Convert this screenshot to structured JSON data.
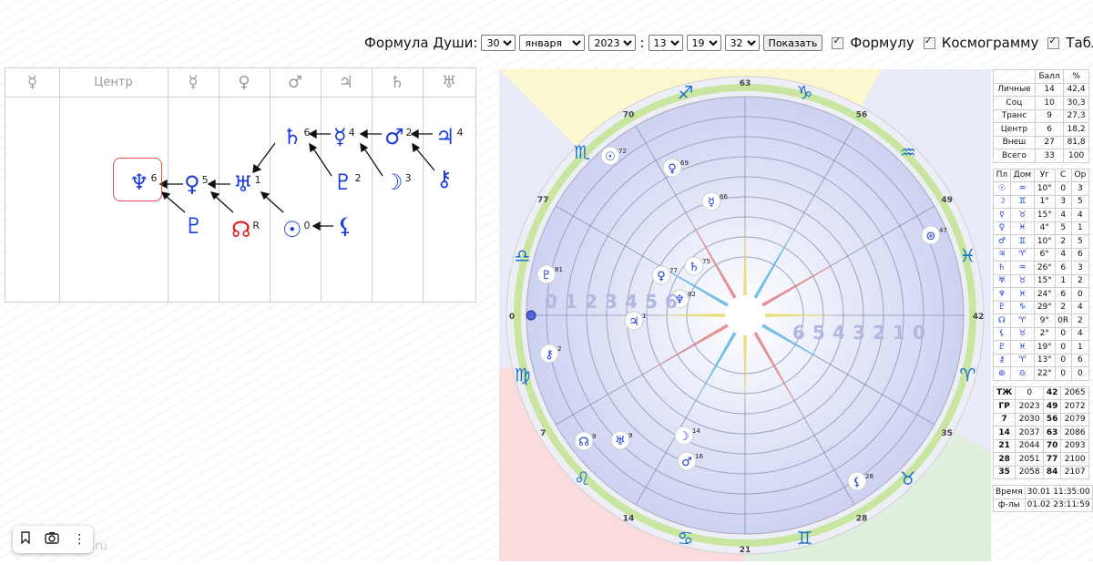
{
  "controls": {
    "label": "Формула Души:",
    "day": "30",
    "month": "января",
    "year": "2023",
    "hour": "13",
    "minute": "19",
    "second": "32",
    "show_button": "Показать",
    "toggles": [
      "Формулу",
      "Космограмму",
      "Табли"
    ]
  },
  "formula": {
    "header": [
      "☿",
      "Центр",
      "☿",
      "♀",
      "♂",
      "♃",
      "♄",
      "♅"
    ],
    "nodes": [
      {
        "id": "neptune",
        "glyph": "♆",
        "num": "6"
      },
      {
        "id": "venus",
        "glyph": "♀",
        "num": "5"
      },
      {
        "id": "uranus",
        "glyph": "♅",
        "num": "1"
      },
      {
        "id": "saturn",
        "glyph": "♄",
        "num": "6"
      },
      {
        "id": "mercury",
        "glyph": "☿",
        "num": "4"
      },
      {
        "id": "mars",
        "glyph": "♂",
        "num": "2"
      },
      {
        "id": "jupiter",
        "glyph": "♃",
        "num": "4"
      },
      {
        "id": "pluto",
        "glyph": "♇",
        "num": "2"
      },
      {
        "id": "moon",
        "glyph": "☽",
        "num": "3"
      },
      {
        "id": "chiron",
        "glyph": "⚷",
        "num": ""
      },
      {
        "id": "proserpina",
        "glyph": "♇",
        "num": ""
      },
      {
        "id": "node",
        "glyph": "☊",
        "num": "R"
      },
      {
        "id": "sun",
        "glyph": "☉",
        "num": "0"
      },
      {
        "id": "lilith",
        "glyph": "⚸",
        "num": ""
      }
    ]
  },
  "cosmogram": {
    "zodiac": [
      "♑",
      "♐",
      "♏",
      "♎",
      "♍",
      "♌",
      "♋",
      "♊",
      "♉",
      "♈",
      "♓",
      "♒"
    ],
    "degree_marks": [
      "63",
      "56",
      "49",
      "42",
      "35",
      "28",
      "21",
      "14",
      "7",
      "0",
      "77",
      "70"
    ],
    "planets": [
      {
        "glyph": "☉",
        "num": "72"
      },
      {
        "glyph": "♀",
        "num": "69"
      },
      {
        "glyph": "☿",
        "num": "66"
      },
      {
        "glyph": "♇",
        "num": "81"
      },
      {
        "glyph": "♀",
        "num": "77"
      },
      {
        "glyph": "♄",
        "num": "75"
      },
      {
        "glyph": "♆",
        "num": "82"
      },
      {
        "glyph": "♃",
        "num": "1"
      },
      {
        "glyph": "⚷",
        "num": "2"
      },
      {
        "glyph": "♅",
        "num": "9"
      },
      {
        "glyph": "☊",
        "num": "9"
      },
      {
        "glyph": "☽",
        "num": "14"
      },
      {
        "glyph": "♂",
        "num": "16"
      },
      {
        "glyph": "⚸",
        "num": "28"
      },
      {
        "glyph": "⊛",
        "num": "47"
      }
    ],
    "scale_numbers": [
      "0",
      "1",
      "2",
      "3",
      "4",
      "5",
      "6"
    ]
  },
  "score_table": {
    "head": [
      "",
      "Балл",
      "%"
    ],
    "rows": [
      [
        "Личные",
        "14",
        "42,4"
      ],
      [
        "Соц",
        "10",
        "30,3"
      ],
      [
        "Транс",
        "9",
        "27,3"
      ],
      [
        "Центр",
        "6",
        "18,2"
      ],
      [
        "Внеш",
        "27",
        "81,8"
      ],
      [
        "Всего",
        "33",
        "100"
      ]
    ]
  },
  "planet_table": {
    "head": [
      "Пл",
      "Дом",
      "Уг",
      "С",
      "Ор"
    ],
    "rows": [
      [
        "☉",
        "♒",
        "10°",
        "0",
        "3"
      ],
      [
        "☽",
        "♊",
        "1°",
        "3",
        "5"
      ],
      [
        "☿",
        "♉",
        "15°",
        "4",
        "4"
      ],
      [
        "♀",
        "♓",
        "4°",
        "5",
        "1"
      ],
      [
        "♂",
        "♊",
        "10°",
        "2",
        "5"
      ],
      [
        "♃",
        "♈",
        "6°",
        "4",
        "6"
      ],
      [
        "♄",
        "♒",
        "26°",
        "6",
        "3"
      ],
      [
        "♅",
        "♉",
        "15°",
        "1",
        "2"
      ],
      [
        "♆",
        "♓",
        "24°",
        "6",
        "0"
      ],
      [
        "♇",
        "♑",
        "29°",
        "2",
        "4"
      ],
      [
        "☊",
        "♈",
        "9°",
        "0R",
        "2"
      ],
      [
        "⚸",
        "♉",
        "2°",
        "0",
        "4"
      ],
      [
        "♇",
        "♓",
        "19°",
        "0",
        "1"
      ],
      [
        "⚷",
        "♈",
        "13°",
        "0",
        "6"
      ],
      [
        "⊛",
        "♎",
        "22°",
        "0",
        "0"
      ]
    ]
  },
  "year_table": {
    "rows": [
      [
        "ТЖ",
        "0",
        "42",
        "2065"
      ],
      [
        "ГР",
        "2023",
        "49",
        "2072"
      ],
      [
        "7",
        "2030",
        "56",
        "2079"
      ],
      [
        "14",
        "2037",
        "63",
        "2086"
      ],
      [
        "21",
        "2044",
        "70",
        "2093"
      ],
      [
        "28",
        "2051",
        "77",
        "2100"
      ],
      [
        "35",
        "2058",
        "84",
        "2107"
      ]
    ]
  },
  "time_table": {
    "rows": [
      [
        "Время",
        "30.01 11:35:00"
      ],
      [
        "ф-лы",
        "01.02 23:11:59"
      ]
    ]
  },
  "toolbox": {
    "bookmark": "bookmark-icon",
    "camera": "camera-icon",
    "more": "more-icon"
  },
  "watermark": ".ru"
}
